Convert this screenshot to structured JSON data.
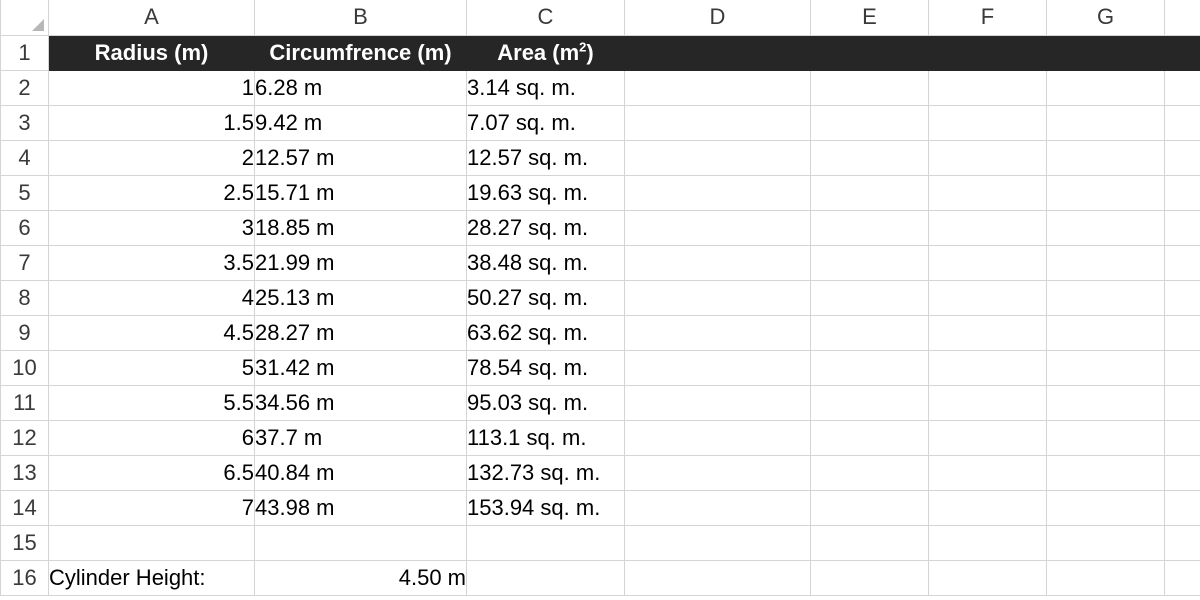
{
  "columns": [
    "A",
    "B",
    "C",
    "D",
    "E",
    "F",
    "G"
  ],
  "rows": [
    "1",
    "2",
    "3",
    "4",
    "5",
    "6",
    "7",
    "8",
    "9",
    "10",
    "11",
    "12",
    "13",
    "14",
    "15",
    "16"
  ],
  "header": {
    "radius": "Radius (m)",
    "circumference": "Circumfrence (m)",
    "area_prefix": "Area (m",
    "area_sup": "2",
    "area_suffix": ")"
  },
  "table": [
    {
      "radius": "1",
      "circ": "6.28 m",
      "area": "3.14 sq. m."
    },
    {
      "radius": "1.5",
      "circ": "9.42 m",
      "area": "7.07 sq. m."
    },
    {
      "radius": "2",
      "circ": "12.57 m",
      "area": "12.57 sq. m."
    },
    {
      "radius": "2.5",
      "circ": "15.71 m",
      "area": "19.63 sq. m."
    },
    {
      "radius": "3",
      "circ": "18.85 m",
      "area": "28.27 sq. m."
    },
    {
      "radius": "3.5",
      "circ": "21.99 m",
      "area": "38.48 sq. m."
    },
    {
      "radius": "4",
      "circ": "25.13 m",
      "area": "50.27 sq. m."
    },
    {
      "radius": "4.5",
      "circ": "28.27 m",
      "area": "63.62 sq. m."
    },
    {
      "radius": "5",
      "circ": "31.42 m",
      "area": "78.54 sq. m."
    },
    {
      "radius": "5.5",
      "circ": "34.56 m",
      "area": "95.03 sq. m."
    },
    {
      "radius": "6",
      "circ": "37.7 m",
      "area": "113.1 sq. m."
    },
    {
      "radius": "6.5",
      "circ": "40.84 m",
      "area": "132.73 sq. m."
    },
    {
      "radius": "7",
      "circ": "43.98 m",
      "area": "153.94 sq. m."
    }
  ],
  "footer": {
    "label": "Cylinder Height:",
    "value": "4.50 m"
  },
  "colors": {
    "header_fill": "#262626",
    "header_text": "#ffffff",
    "gridline": "#d4d4d4"
  }
}
